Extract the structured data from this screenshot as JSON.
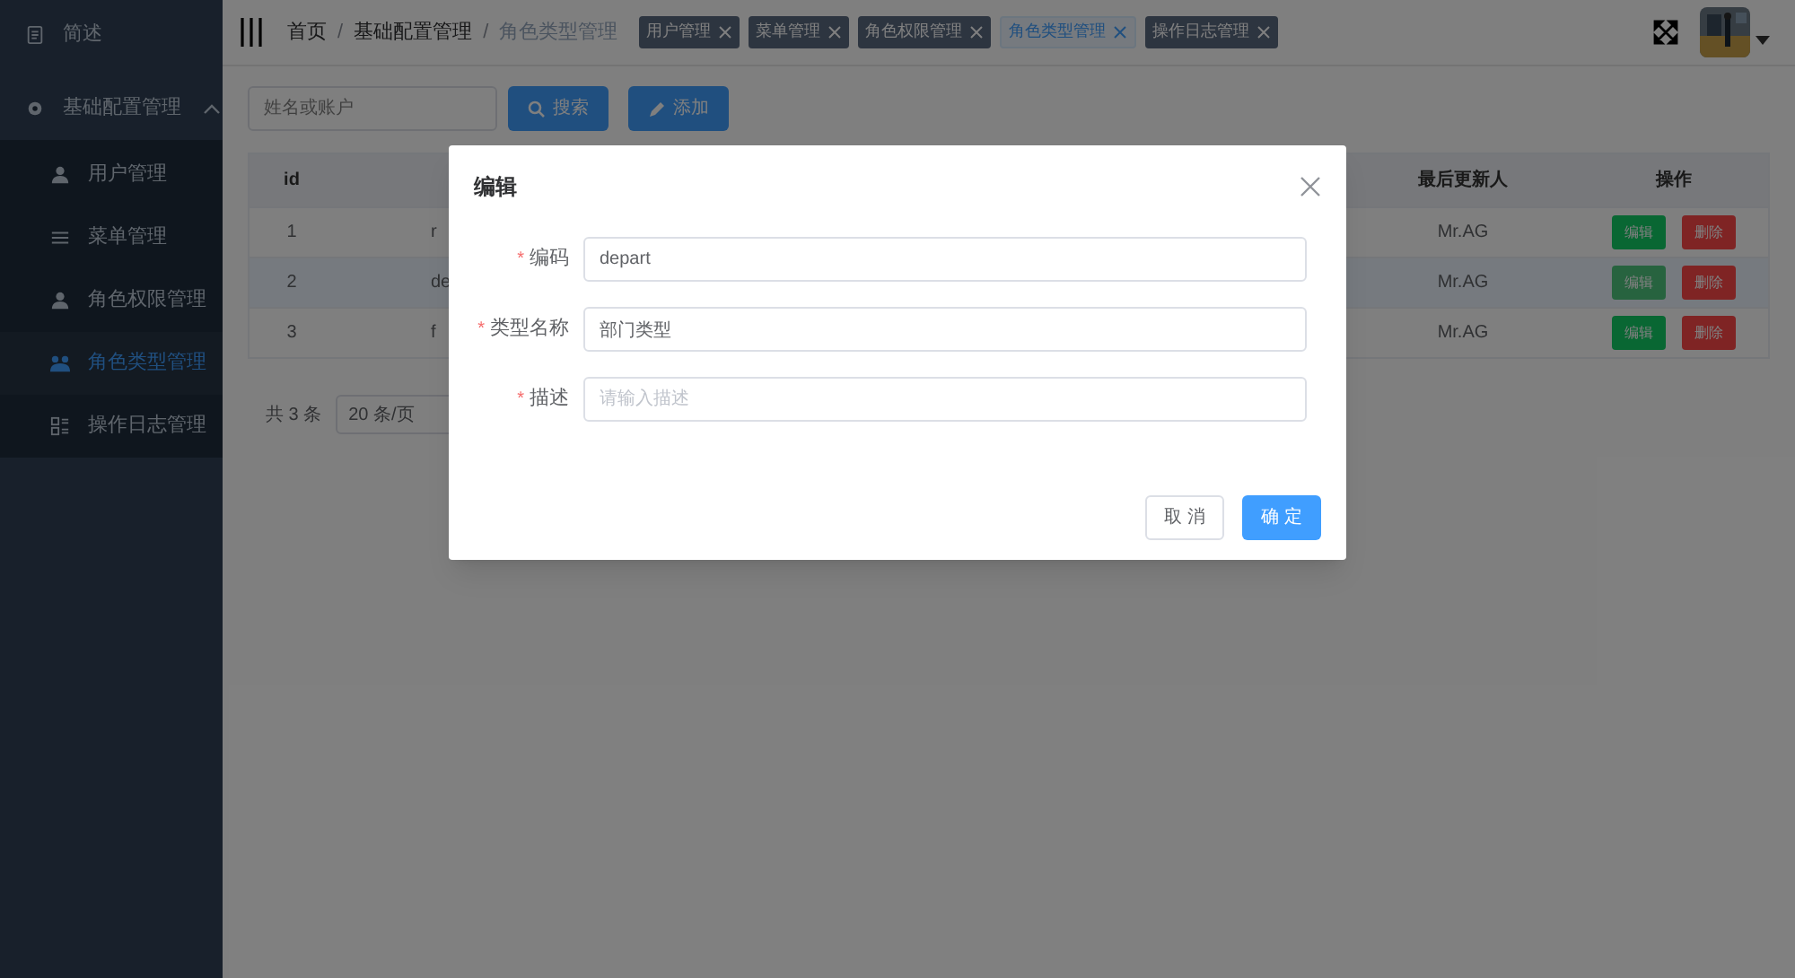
{
  "sidebar": {
    "items": [
      {
        "label": "简述",
        "kind": "doc",
        "selected": false
      },
      {
        "label": "基础配置管理",
        "kind": "gear",
        "expanded": true,
        "selected": false,
        "children": [
          {
            "label": "用户管理",
            "kind": "user",
            "selected": false
          },
          {
            "label": "菜单管理",
            "kind": "list",
            "selected": false
          },
          {
            "label": "角色权限管理",
            "kind": "user",
            "selected": false
          },
          {
            "label": "角色类型管理",
            "kind": "group",
            "selected": true
          },
          {
            "label": "操作日志管理",
            "kind": "log",
            "selected": false
          }
        ]
      }
    ]
  },
  "breadcrumb": [
    {
      "label": "首页"
    },
    {
      "separator": "/",
      "label": "基础配置管理"
    },
    {
      "separator": "/",
      "label": "角色类型管理"
    }
  ],
  "tags": [
    {
      "label": "用户管理",
      "selected": false
    },
    {
      "label": "菜单管理",
      "selected": false
    },
    {
      "label": "角色权限管理",
      "selected": false
    },
    {
      "label": "角色类型管理",
      "selected": true
    },
    {
      "label": "操作日志管理",
      "selected": false
    }
  ],
  "toolbar": {
    "search": {
      "placeholder": "姓名或账户"
    },
    "buttons": [
      {
        "label": "搜索",
        "kind": "search"
      },
      {
        "label": "添加",
        "kind": "add"
      }
    ]
  },
  "table": {
    "columns": [
      "id",
      "最后更新人",
      "操作"
    ],
    "rows": [
      {
        "id": "1",
        "column_2": "r",
        "updater": "Mr.AG",
        "selected": false,
        "actions": [
          "编辑",
          "删除"
        ]
      },
      {
        "id": "2",
        "column_2": "de",
        "updater": "Mr.AG",
        "selected": true,
        "actions": [
          "编辑",
          "删除"
        ]
      },
      {
        "id": "3",
        "column_2": "f",
        "updater": "Mr.AG",
        "selected": false,
        "actions": [
          "编辑",
          "删除"
        ]
      }
    ]
  },
  "pagination": {
    "total": "共 3 条",
    "page_size": "20 条/页"
  },
  "dialog": {
    "title": "编辑",
    "fields": [
      {
        "required_mark": "*",
        "label": "编码",
        "value": "depart"
      },
      {
        "required_mark": "*",
        "label": "类型名称",
        "value": "部门类型"
      },
      {
        "required_mark": "*",
        "label": "描述",
        "placeholder": "请输入描述"
      }
    ],
    "buttons": [
      {
        "label": "取 消",
        "kind": "secondary"
      },
      {
        "label": "确 定",
        "kind": "primary"
      }
    ]
  }
}
